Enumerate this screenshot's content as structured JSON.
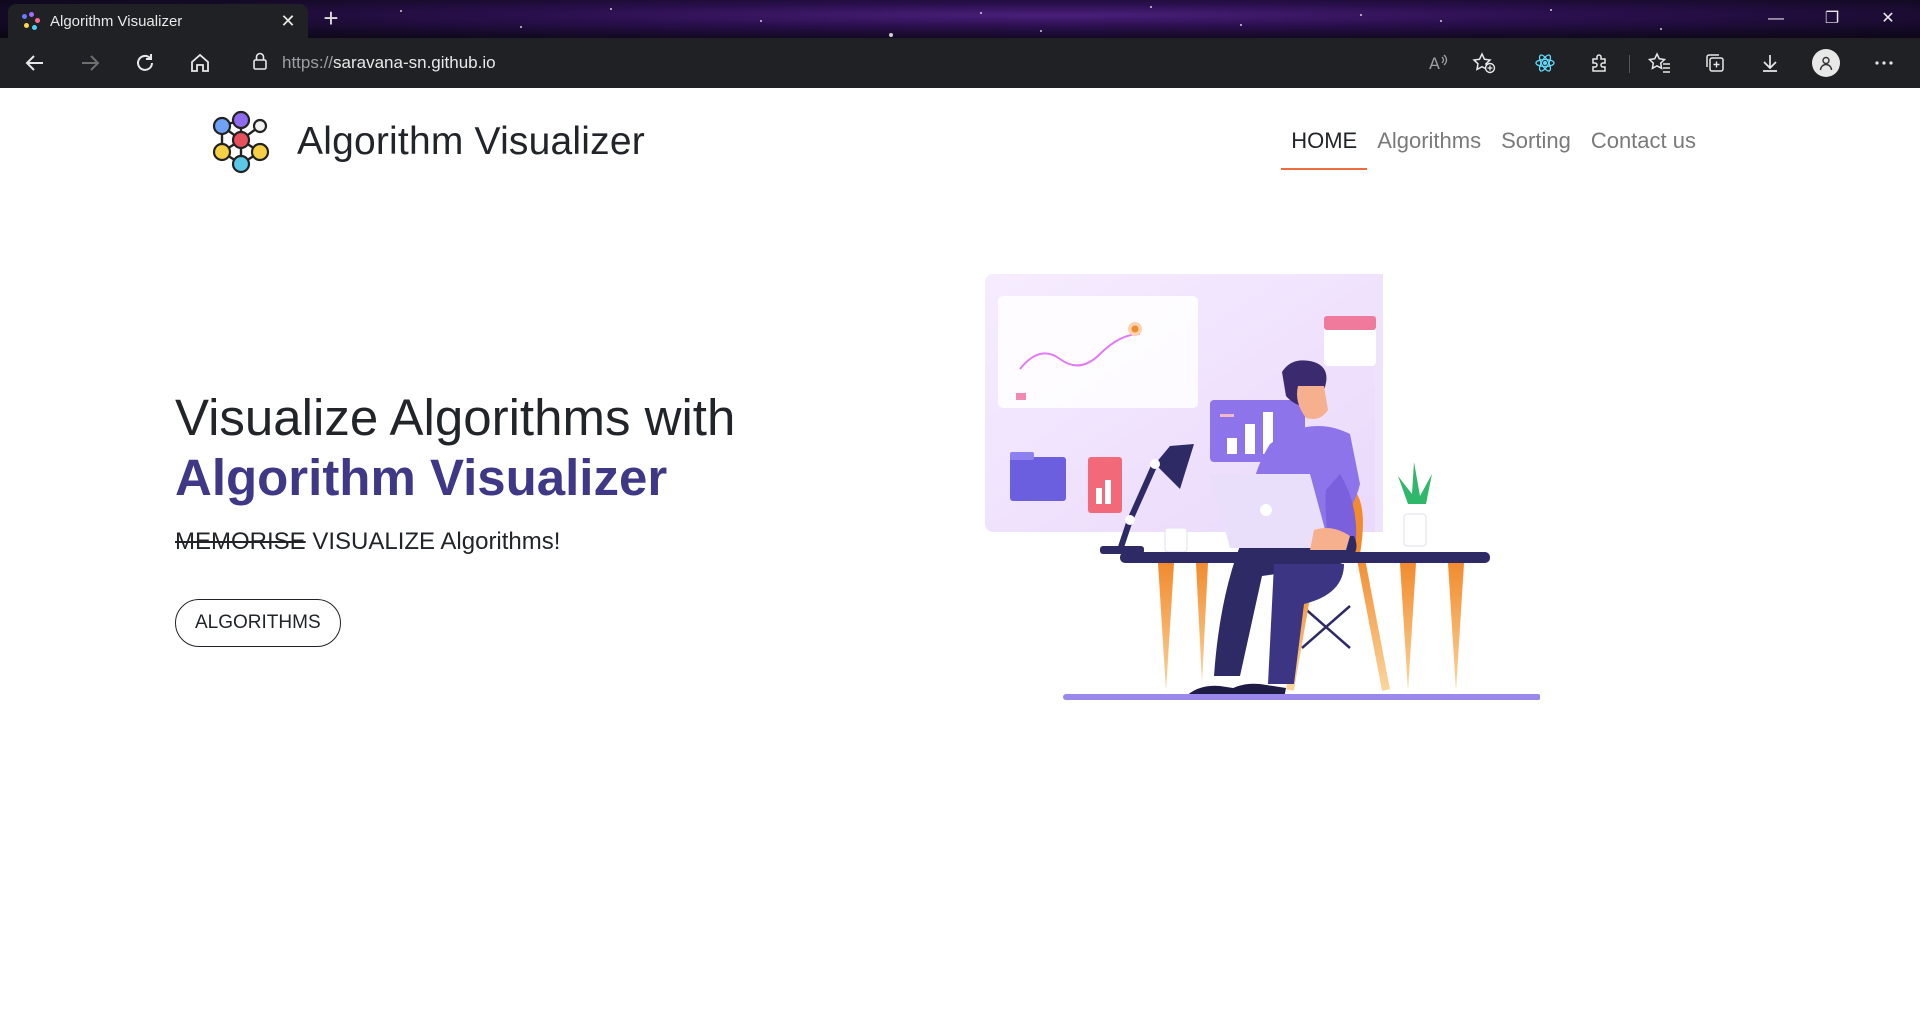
{
  "browser": {
    "tab_title": "Algorithm Visualizer",
    "tab_close": "✕",
    "new_tab": "+",
    "url_protocol": "https://",
    "url_host": "saravana-sn.github.io",
    "window_controls": {
      "minimize": "—",
      "restore": "❐",
      "close": "✕"
    },
    "icons": [
      "back-icon",
      "forward-icon",
      "refresh-icon",
      "home-icon",
      "lock-icon",
      "read-aloud-icon",
      "add-favorite-icon",
      "react-devtools-icon",
      "extensions-icon",
      "favorites-icon",
      "collections-icon",
      "download-icon",
      "profile-icon",
      "more-icon"
    ]
  },
  "site": {
    "brand": "Algorithm Visualizer",
    "nav": [
      {
        "label": "HOME",
        "active": true
      },
      {
        "label": "Algorithms",
        "active": false
      },
      {
        "label": "Sorting",
        "active": false
      },
      {
        "label": "Contact us",
        "active": false
      }
    ]
  },
  "hero": {
    "title_line1": "Visualize Algorithms with",
    "title_line2": "Algorithm Visualizer",
    "subtitle_struck": "MEMORISE",
    "subtitle_rest": " VISUALIZE Algorithms!",
    "cta_label": "ALGORITHMS"
  },
  "colors": {
    "accent_purple": "#3e3887",
    "nav_underline": "#f06c3c",
    "text": "#212529",
    "chrome_bg": "#202124"
  }
}
